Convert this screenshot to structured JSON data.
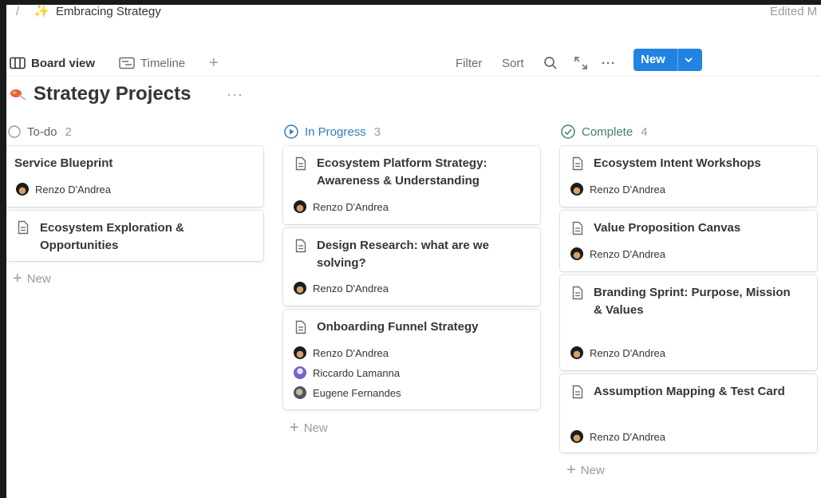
{
  "breadcrumb": {
    "dots": ".",
    "separator": "/",
    "icon": "sparkles-icon",
    "title": "Embracing Strategy"
  },
  "edited_label": "Edited M",
  "views": {
    "board": "Board view",
    "timeline": "Timeline",
    "add": "+"
  },
  "toolbar": {
    "filter": "Filter",
    "sort": "Sort",
    "more": "···",
    "new": "New"
  },
  "page": {
    "title": "Strategy Projects",
    "more": "···"
  },
  "columns": [
    {
      "name": "To-do",
      "count": "2",
      "color": "#787774",
      "cards": [
        {
          "title": "Service Blueprint",
          "people": [
            "Renzo D'Andrea"
          ]
        },
        {
          "title": "Ecosystem Exploration & Opportunities",
          "people": []
        }
      ],
      "add_label": "New"
    },
    {
      "name": "In Progress",
      "count": "3",
      "color": "#2e7fb8",
      "cards": [
        {
          "title": "Ecosystem Platform Strategy: Awareness & Understanding",
          "people": [
            "Renzo D'Andrea"
          ]
        },
        {
          "title": "Design Research: what are we solving?",
          "people": [
            "Renzo D'Andrea"
          ]
        },
        {
          "title": "Onboarding Funnel Strategy",
          "people": [
            "Renzo D'Andrea",
            "Riccardo Lamanna",
            "Eugene Fernandes"
          ]
        }
      ],
      "add_label": "New"
    },
    {
      "name": "Complete",
      "count": "4",
      "color": "#448361",
      "cards": [
        {
          "title": "Ecosystem Intent Workshops",
          "people": [
            "Renzo D'Andrea"
          ]
        },
        {
          "title": "Value Proposition Canvas",
          "people": [
            "Renzo D'Andrea"
          ]
        },
        {
          "title": "Branding Sprint: Purpose, Mission & Values",
          "people": [
            "Renzo D'Andrea"
          ]
        },
        {
          "title": "Assumption Mapping & Test Card",
          "people": [
            "Renzo D'Andrea"
          ]
        }
      ],
      "add_label": "New"
    }
  ],
  "colors": {
    "accent": "#2383e2",
    "text": "#37352f",
    "muted": "#9b9a97"
  }
}
